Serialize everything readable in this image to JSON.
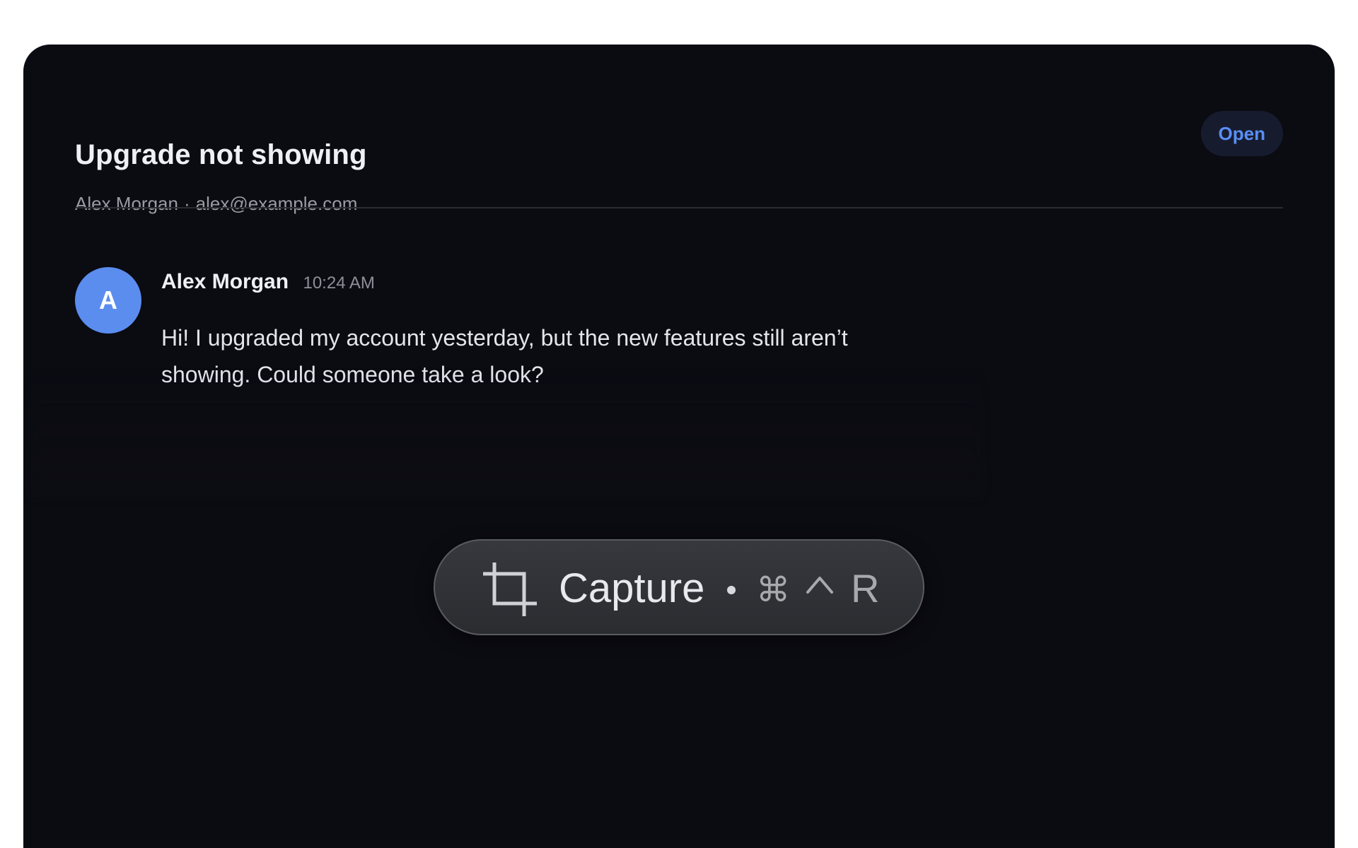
{
  "ticket": {
    "title": "Upgrade not showing",
    "customer_name": "Alex Morgan",
    "meta_separator": "·",
    "customer_email": "alex@example.com",
    "status": "Open"
  },
  "message": {
    "avatar_initial": "A",
    "sender": "Alex Morgan",
    "time": "10:24 AM",
    "body": "Hi! I upgraded my account yesterday, but the new features still aren’t showing. Could someone take a look?"
  },
  "capture_toolbar": {
    "icon": "crop-icon",
    "label": "Capture",
    "separator": "•",
    "shortcut_modifier_1": "⌘",
    "shortcut_modifier_2": "control",
    "shortcut_key": "R"
  },
  "colors": {
    "panel_background": "#0b0b12",
    "accent_blue": "#5a8ef5",
    "avatar_blue": "#5b8def"
  }
}
